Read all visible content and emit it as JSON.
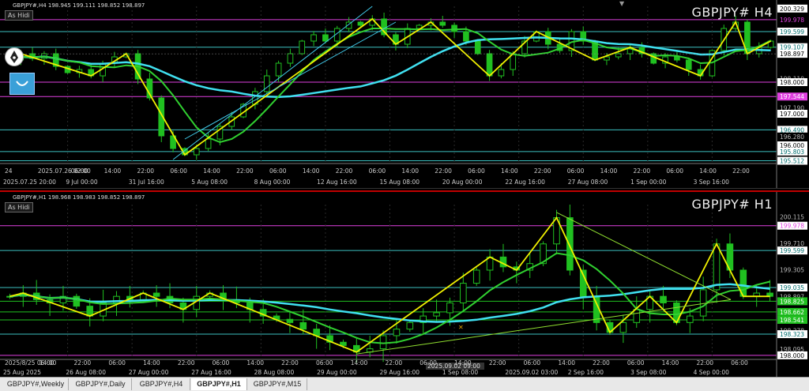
{
  "charts": {
    "h4": {
      "info": "GBPJPY#,H4  198.945 199.111 198.852 198.897",
      "symbol": "GBPJPY# H4",
      "hide_button": "As Hidi",
      "ylim": [
        195.45,
        200.4
      ],
      "price_labels": [
        {
          "value": 200.329,
          "text": "200.329",
          "bg": "#ffffff",
          "fg": "#000000"
        },
        {
          "value": 199.978,
          "text": "199.978",
          "bg": "#000000",
          "fg": "#e040e0"
        },
        {
          "value": 199.599,
          "text": "199.599",
          "bg": "#ffffff",
          "fg": "#006e6e"
        },
        {
          "value": 199.107,
          "text": "199.107",
          "bg": "#ffffff",
          "fg": "#006e6e"
        },
        {
          "value": 198.897,
          "text": "198.897",
          "bg": "#ffffff",
          "fg": "#000000"
        },
        {
          "value": 198.11,
          "text": "198.110",
          "bg": "#000000",
          "fg": "#bbbbbb"
        },
        {
          "value": 198.0,
          "text": "198.000",
          "bg": "#ffffff",
          "fg": "#000000"
        },
        {
          "value": 197.544,
          "text": "197.544",
          "bg": "#e040e0",
          "fg": "#ffffff"
        },
        {
          "value": 197.19,
          "text": "197.190",
          "bg": "#000000",
          "fg": "#bbbbbb"
        },
        {
          "value": 197.0,
          "text": "197.000",
          "bg": "#ffffff",
          "fg": "#000000"
        },
        {
          "value": 196.49,
          "text": "196.490",
          "bg": "#ffffff",
          "fg": "#006e6e"
        },
        {
          "value": 196.28,
          "text": "196.280",
          "bg": "#000000",
          "fg": "#bbbbbb"
        },
        {
          "value": 196.0,
          "text": "196.000",
          "bg": "#ffffff",
          "fg": "#000000"
        },
        {
          "value": 195.803,
          "text": "195.803",
          "bg": "#ffffff",
          "fg": "#006e6e"
        },
        {
          "value": 195.512,
          "text": "195.512",
          "bg": "#ffffff",
          "fg": "#006e6e"
        }
      ],
      "hlines": [
        {
          "value": 199.978,
          "color": "#e040e0"
        },
        {
          "value": 199.599,
          "color": "#3cc0c0"
        },
        {
          "value": 199.107,
          "color": "#3cc0c0"
        },
        {
          "value": 198.0,
          "color": "#e040e0"
        },
        {
          "value": 197.544,
          "color": "#e040e0"
        },
        {
          "value": 196.49,
          "color": "#3cc0c0"
        },
        {
          "value": 195.803,
          "color": "#3cc0c0"
        },
        {
          "value": 195.512,
          "color": "#3cc0c0"
        }
      ],
      "time_labels": [
        "24 ",
        "2025.07.26 02:00",
        "06:00",
        "14:00",
        "22:00",
        "06:00",
        "14:00",
        "22:00",
        "06:00",
        "14:00",
        "22:00",
        "06:00",
        "14:00",
        "22:00",
        "06:00",
        "14:00",
        "22:00",
        "06:00",
        "14:00",
        "22:00",
        "06:00",
        "14:00",
        "22:00"
      ],
      "date_labels": [
        "2025.07.25 20:00",
        "9 Jul 00:00",
        "31 Jul 16:00",
        "5 Aug 08:00",
        "8 Aug 00:00",
        "12 Aug 16:00",
        "15 Aug 08:00",
        "20 Aug 00:00",
        "22 Aug 16:00",
        "27 Aug 08:00",
        "1 Sep 00:00",
        "3 Sep 16:00"
      ],
      "close_prices": [
        198.7,
        198.9,
        198.75,
        198.9,
        198.5,
        198.3,
        198.4,
        198.2,
        198.6,
        198.8,
        198.9,
        198.1,
        197.5,
        196.3,
        195.9,
        195.7,
        195.9,
        196.2,
        196.6,
        196.9,
        197.3,
        197.7,
        198.2,
        198.6,
        198.9,
        199.3,
        199.5,
        199.3,
        199.7,
        199.9,
        199.8,
        200.0,
        199.5,
        199.2,
        199.7,
        199.8,
        199.9,
        199.8,
        199.6,
        199.3,
        198.9,
        198.2,
        198.4,
        198.9,
        199.3,
        199.6,
        199.2,
        199.0,
        199.6,
        199.3,
        198.7,
        198.8,
        198.9,
        199.1,
        198.9,
        198.6,
        198.8,
        198.7,
        198.4,
        198.2,
        199.0,
        199.7,
        199.9,
        198.9,
        199.1,
        199.3
      ]
    },
    "h1": {
      "info": "GBPJPY#,H1  198.968 198.983 198.852 198.897",
      "symbol": "GBPJPY# H1",
      "hide_button": "As Hidi",
      "ylim": [
        197.95,
        200.3
      ],
      "price_labels": [
        {
          "value": 200.115,
          "text": "200.115",
          "bg": "#000000",
          "fg": "#bbbbbb"
        },
        {
          "value": 199.978,
          "text": "199.978",
          "bg": "#ffffff",
          "fg": "#e040e0"
        },
        {
          "value": 199.71,
          "text": "199.710",
          "bg": "#000000",
          "fg": "#bbbbbb"
        },
        {
          "value": 199.599,
          "text": "199.599",
          "bg": "#ffffff",
          "fg": "#006e6e"
        },
        {
          "value": 199.305,
          "text": "199.305",
          "bg": "#000000",
          "fg": "#bbbbbb"
        },
        {
          "value": 199.035,
          "text": "199.035",
          "bg": "#ffffff",
          "fg": "#006e6e"
        },
        {
          "value": 198.897,
          "text": "198.897",
          "bg": "#000000",
          "fg": "#bbbbbb"
        },
        {
          "value": 198.825,
          "text": "198.825",
          "bg": "#20c020",
          "fg": "#ffffff"
        },
        {
          "value": 198.662,
          "text": "198.662",
          "bg": "#20c020",
          "fg": "#ffffff"
        },
        {
          "value": 198.541,
          "text": "198.541",
          "bg": "#20c020",
          "fg": "#ffffff"
        },
        {
          "value": 198.378,
          "text": "198.378",
          "bg": "#000000",
          "fg": "#bbbbbb"
        },
        {
          "value": 198.323,
          "text": "198.323",
          "bg": "#ffffff",
          "fg": "#006e6e"
        },
        {
          "value": 198.095,
          "text": "198.095",
          "bg": "#000000",
          "fg": "#bbbbbb"
        },
        {
          "value": 198.0,
          "text": "198.000",
          "bg": "#ffffff",
          "fg": "#000000"
        }
      ],
      "hlines": [
        {
          "value": 199.978,
          "color": "#e040e0"
        },
        {
          "value": 199.599,
          "color": "#3cc0c0"
        },
        {
          "value": 199.035,
          "color": "#3cc0c0"
        },
        {
          "value": 198.825,
          "color": "#20c020"
        },
        {
          "value": 198.662,
          "color": "#20c020"
        },
        {
          "value": 198.541,
          "color": "#20c020"
        },
        {
          "value": 198.323,
          "color": "#3cc0c0"
        },
        {
          "value": 198.0,
          "color": "#e040e0"
        }
      ],
      "time_labels": [
        "2025/8/25 06:00",
        "14:00",
        "22:00",
        "06:00",
        "14:00",
        "22:00",
        "06:00",
        "14:00",
        "22:00",
        "06:00",
        "14:00",
        "22:00",
        "06:00",
        "14:00",
        "22:00",
        "06:00",
        "14:00",
        "22:00",
        "06:00",
        "14:00",
        "22:00",
        "06:00"
      ],
      "date_labels": [
        "25 Aug 2025",
        "26 Aug 08:00",
        "27 Aug 00:00",
        "27 Aug 16:00",
        "28 Aug 08:00",
        "29 Aug 00:00",
        "29 Aug 16:00",
        "1 Sep 08:00",
        "2025.09.02 03:00",
        "2 Sep 16:00",
        "3 Sep 08:00",
        "4 Sep 00:00"
      ],
      "time_marker_top": "2025.09.02 09:00",
      "close_prices": [
        198.9,
        198.95,
        198.85,
        198.8,
        198.9,
        198.75,
        198.6,
        198.8,
        198.9,
        198.85,
        198.95,
        198.9,
        198.8,
        198.7,
        198.9,
        198.95,
        198.85,
        198.8,
        198.7,
        198.6,
        198.55,
        198.5,
        198.4,
        198.3,
        198.2,
        198.15,
        198.05,
        198.1,
        198.3,
        198.4,
        198.5,
        198.6,
        198.65,
        198.8,
        199.1,
        199.3,
        199.5,
        199.35,
        199.3,
        199.4,
        199.7,
        200.1,
        199.3,
        198.9,
        198.5,
        198.35,
        198.5,
        198.7,
        198.9,
        198.8,
        198.5,
        198.6,
        199.0,
        199.7,
        199.3,
        198.9,
        198.95,
        198.9
      ]
    }
  },
  "tabs": [
    "GBPJPY#,Weekly",
    "GBPJPY#,Daily",
    "GBPJPY#,H4",
    "GBPJPY#,H1",
    "GBPJPY#,M15"
  ],
  "active_tab": "GBPJPY#,H1",
  "colors": {
    "price_line": "#3cc0c0",
    "ma_fast": "#30d030",
    "ma_slow": "#40e0f0",
    "zigzag": "#f0f000",
    "zigzag_down": "#e040e0",
    "trend_line": "#90e030",
    "candle": "#20c020"
  },
  "icons": [
    "pen-icon",
    "smile-icon",
    "close-icon",
    "time-marker-icon"
  ]
}
